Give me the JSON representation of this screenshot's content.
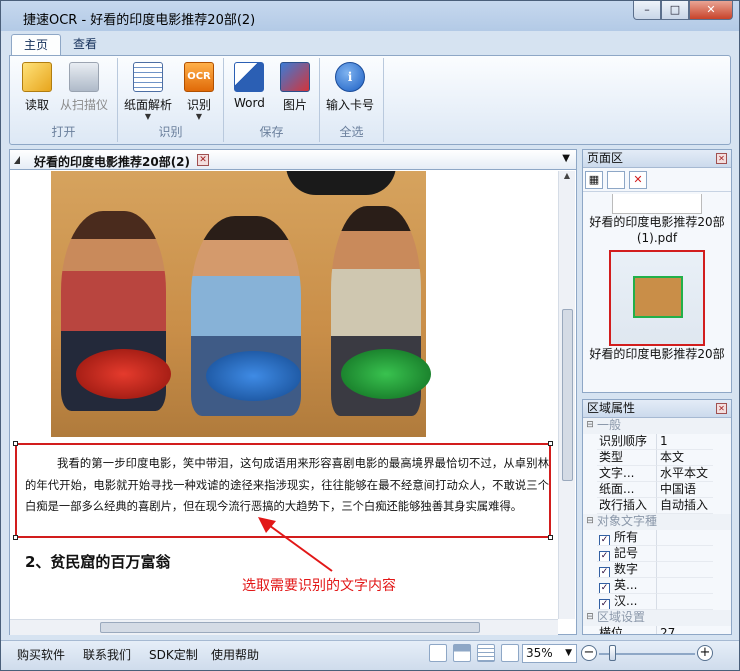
{
  "window": {
    "title": "捷速OCR - 好看的印度电影推荐20部(2)"
  },
  "tabs": [
    {
      "label": "主页"
    },
    {
      "label": "查看"
    }
  ],
  "ribbon": {
    "groups": [
      {
        "name": "打开",
        "buttons": [
          {
            "label": "读取"
          },
          {
            "label": "从扫描仪"
          }
        ]
      },
      {
        "name": "识别",
        "buttons": [
          {
            "label": "纸面解析"
          },
          {
            "label": "识别"
          }
        ]
      },
      {
        "name": "保存",
        "buttons": [
          {
            "label": "Word"
          },
          {
            "label": "图片"
          }
        ]
      },
      {
        "name": "全选",
        "buttons": [
          {
            "label": "输入卡号"
          }
        ]
      }
    ],
    "ocr_icon_text": "OCR"
  },
  "document": {
    "tab_title": "好看的印度电影推荐20部(2)",
    "paragraph": "我看的第一步印度电影，笑中带泪，这句成语用来形容喜剧电影的最高境界最恰切不过，从卓别林的年代开始，电影就开始寻找一种戏谑的途径来指涉现实，往往能够在最不经意间打动众人，不敢说三个白痴是一部多么经典的喜剧片，但在现今流行恶搞的大趋势下，三个白痴还能够独善其身实属难得。",
    "heading": "2、贫民窟的百万富翁",
    "annotation": "选取需要识别的文字内容"
  },
  "page_panel": {
    "title": "页面区",
    "thumb1_caption": "好看的印度电影推荐20部(1).pdf",
    "thumb2_caption": "好看的印度电影推荐20部"
  },
  "props_panel": {
    "title": "区域属性",
    "cat_general": "一般",
    "rows": [
      {
        "k": "识别顺序",
        "v": "1"
      },
      {
        "k": "类型",
        "v": "本文"
      },
      {
        "k": "文字...",
        "v": "水平本文"
      },
      {
        "k": "纸面...",
        "v": "中国语"
      },
      {
        "k": "改行插入",
        "v": "自动插入"
      }
    ],
    "cat_type": "对象文字種",
    "checks": [
      {
        "k": "所有"
      },
      {
        "k": "記号"
      },
      {
        "k": "数字"
      },
      {
        "k": "英..."
      },
      {
        "k": "汉..."
      }
    ],
    "cat_region": "区域设置",
    "last_row": {
      "k": "横位...",
      "v": "27"
    }
  },
  "status": {
    "links": [
      "购买软件",
      "联系我们",
      "SDK定制",
      "使用帮助"
    ],
    "zoom": "35%"
  }
}
